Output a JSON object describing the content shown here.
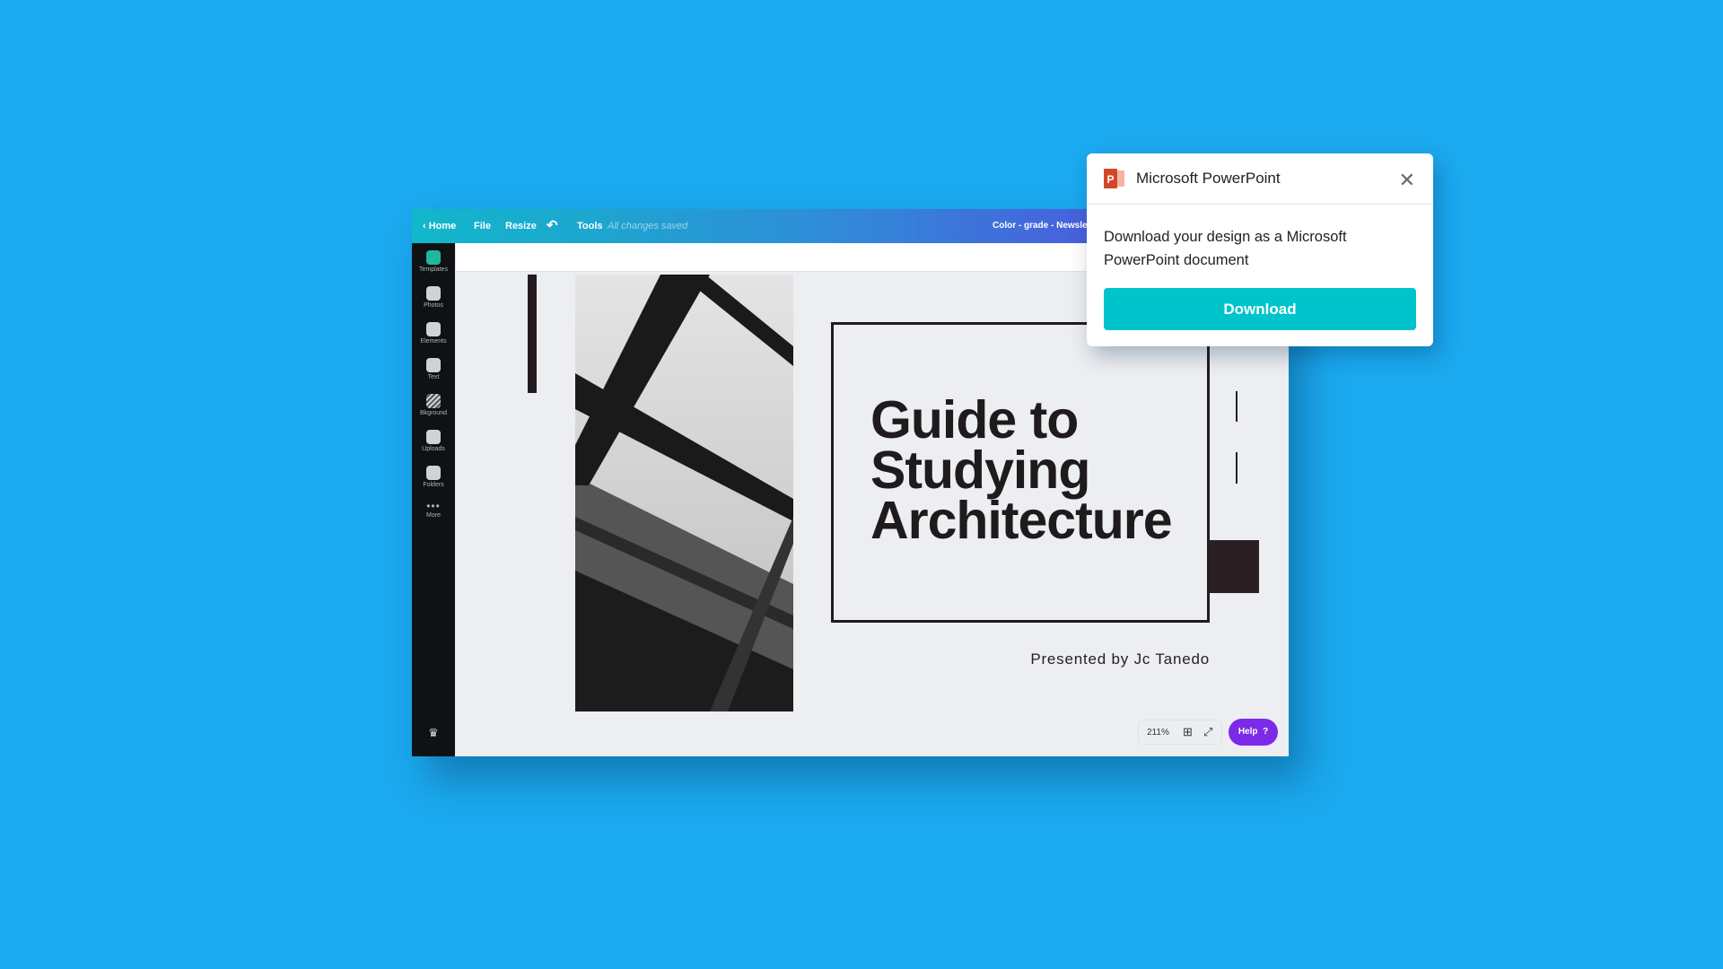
{
  "topbar": {
    "home": "Home",
    "file": "File",
    "resize": "Resize",
    "tools": "Tools",
    "status": "All changes saved",
    "doc_title": "Color - grade - Newslet"
  },
  "sidebar": {
    "items": [
      {
        "label": "Templates",
        "icon": "templates-icon"
      },
      {
        "label": "Photos",
        "icon": "photos-icon"
      },
      {
        "label": "Elements",
        "icon": "elements-icon"
      },
      {
        "label": "Text",
        "icon": "text-icon"
      },
      {
        "label": "Bkground",
        "icon": "background-icon"
      },
      {
        "label": "Uploads",
        "icon": "upload-icon"
      },
      {
        "label": "Folders",
        "icon": "folder-icon"
      },
      {
        "label": "More",
        "icon": "more-icon"
      }
    ]
  },
  "canvas": {
    "title_lines": [
      "Guide to",
      "Studying",
      "Architecture"
    ],
    "presenter": "Presented by Jc Tanedo"
  },
  "footer": {
    "zoom": "211%",
    "help": "Help",
    "help_icon": "?"
  },
  "popup": {
    "title": "Microsoft PowerPoint",
    "description": "Download your design as a Microsoft PowerPoint document",
    "button": "Download"
  },
  "colors": {
    "background": "#1ba9ef",
    "accent": "#00c4cc",
    "help": "#7d2ae8",
    "powerpoint": "#d24726"
  }
}
